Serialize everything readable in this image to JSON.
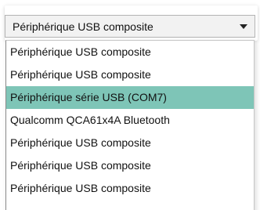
{
  "combo": {
    "value": "Périphérique USB composite",
    "arrow_icon": "chevron-down-icon"
  },
  "dropdown": {
    "items": [
      {
        "label": "Périphérique USB composite",
        "selected": false
      },
      {
        "label": "Périphérique USB composite",
        "selected": false
      },
      {
        "label": "Périphérique série USB (COM7)",
        "selected": true
      },
      {
        "label": "Qualcomm QCA61x4A Bluetooth",
        "selected": false
      },
      {
        "label": "Périphérique USB composite",
        "selected": false
      },
      {
        "label": "Périphérique USB composite",
        "selected": false
      },
      {
        "label": "Périphérique USB composite",
        "selected": false
      }
    ],
    "highlight_color": "#7ec5b7"
  }
}
